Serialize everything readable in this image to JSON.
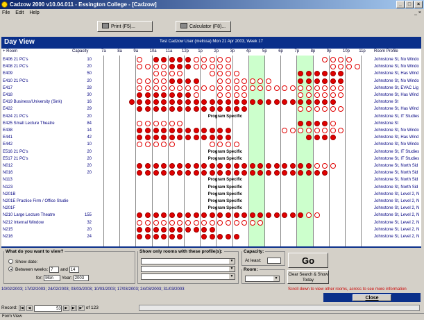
{
  "window": {
    "title": "Cadzow 2000 v10.04.011 - Essington College - [Cadzow]",
    "controls": [
      "_",
      "□",
      "×"
    ]
  },
  "menu": {
    "items": [
      "File",
      "Edit",
      "Help"
    ],
    "mdi_controls": "_ ×"
  },
  "toolbar": {
    "print": "Print (F5)...",
    "calculator": "Calculator (F8)..."
  },
  "header": {
    "title": "Day View",
    "subtitle": "Test Cadzow User (melissa) Mon 21 Apr 2003, Week 17"
  },
  "columns": {
    "room": "+ Room",
    "capacity": "Capacity",
    "times": [
      "7a",
      "8a",
      "9a",
      "10a",
      "11a",
      "12p",
      "1p",
      "2p",
      "3p",
      "4p",
      "5p",
      "6p",
      "7p",
      "8p",
      "9p",
      "10p",
      "11p"
    ],
    "profile": "Room Profile"
  },
  "rows": [
    {
      "room": "E406 21 PC's",
      "capacity": "10",
      "profile": "Johnstone St, No Windo"
    },
    {
      "room": "E408 21 PC's",
      "capacity": "20",
      "profile": "Johnstone St, No Windo"
    },
    {
      "room": "E409",
      "capacity": "50",
      "profile": "Johnstone St, Has Wind"
    },
    {
      "room": "E410 21 PC's",
      "capacity": "20",
      "profile": "Johnstone St, No Windo"
    },
    {
      "room": "E417",
      "capacity": "28",
      "profile": "Johnstone St, EVAC Lig"
    },
    {
      "room": "E418",
      "capacity": "30",
      "profile": "Johnstone St, Has Wind"
    },
    {
      "room": "E419 Business/University (Sink)",
      "capacity": "16",
      "profile": "Johnstone St"
    },
    {
      "room": "E422",
      "capacity": "29",
      "profile": "Johnstone St, Has Wind"
    },
    {
      "room": "E424 21 PC's",
      "capacity": "20",
      "profile": "Johnstone St, IT Studies"
    },
    {
      "room": "E425 Small Lecture Theatre",
      "capacity": "84",
      "profile": "Johnstone St"
    },
    {
      "room": "E438",
      "capacity": "14",
      "profile": "Johnstone St, No Windo"
    },
    {
      "room": "E441",
      "capacity": "42",
      "profile": "Johnstone St, Has Wind"
    },
    {
      "room": "E442",
      "capacity": "10",
      "profile": "Johnstone St, No Windo"
    },
    {
      "room": "E516 21 PC's",
      "capacity": "20",
      "profile": "Johnstone St, IT Studies"
    },
    {
      "room": "E517 21 PC's",
      "capacity": "20",
      "profile": "Johnstone St, IT Studies"
    },
    {
      "room": "N012",
      "capacity": "20",
      "profile": "Johnstone St, North Sid"
    },
    {
      "room": "N016",
      "capacity": "20",
      "profile": "Johnstone St, North Sid"
    },
    {
      "room": "N113",
      "capacity": "",
      "profile": "Johnstone St, North Sid"
    },
    {
      "room": "N123",
      "capacity": "",
      "profile": "Johnstone St, North Sid"
    },
    {
      "room": "N201B",
      "capacity": "",
      "profile": "Johnstone St, Level 2, N"
    },
    {
      "room": "N201E Practice Firm / Office Studie",
      "capacity": "",
      "profile": "Johnstone St, Level 2, N"
    },
    {
      "room": "N201F",
      "capacity": "",
      "profile": "Johnstone St, Level 2, N"
    },
    {
      "room": "N210 Large Lecture Theatre",
      "capacity": "155",
      "profile": "Johnstone St, Level 2, N"
    },
    {
      "room": "N212 Internal Window",
      "capacity": "32",
      "profile": "Johnstone St, Level 2, N"
    },
    {
      "room": "N215",
      "capacity": "20",
      "profile": "Johnstone St, Level 2, N"
    },
    {
      "room": "N216",
      "capacity": "24",
      "profile": "Johnstone St, Level 2, N"
    }
  ],
  "program_specific": "Program Specific",
  "query": {
    "legend": "What do you want to view?",
    "show_date": "Show date:",
    "between": "Between weeks:",
    "week_from": "7",
    "and": "and",
    "week_to": "14",
    "for": "for:",
    "day": "Mon",
    "year_label": "Year:",
    "year": "2003",
    "profiles_legend": "Show only rooms with these profile(s):",
    "capacity_legend": "Capacity:",
    "at_least": "At least:",
    "room_legend": "Room:",
    "go": "Go",
    "clear": "Clear Search & Show Today"
  },
  "dates_list": "10/02/2003; 17/02/2003; 24/02/2003; 03/03/2003; 10/03/2003; 17/03/2003; 24/03/2003; 31/03/2003",
  "scroll_note": "Scroll down to view other rooms, across to see more information",
  "close": "Close",
  "record": {
    "label": "Record:",
    "current": "53",
    "of": "of 123"
  },
  "status": "Form View",
  "colors": {
    "booked": "#e00000",
    "header": "#0a2f8a",
    "available": "#ccffcc"
  }
}
